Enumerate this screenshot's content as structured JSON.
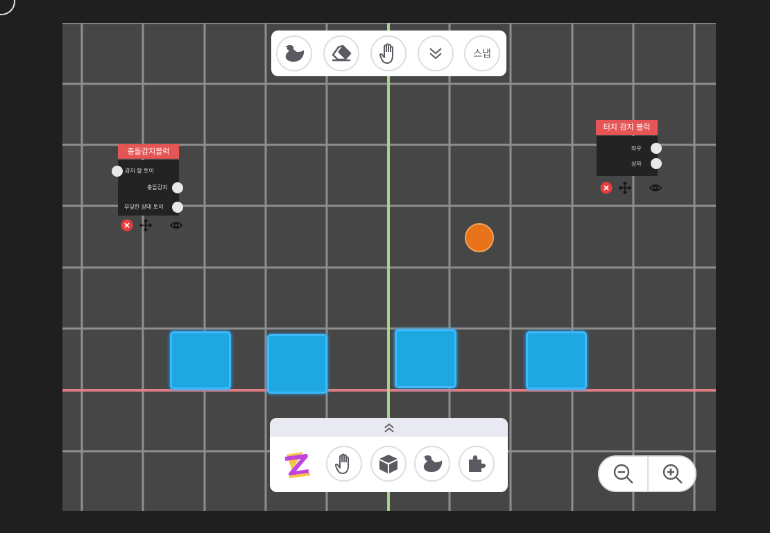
{
  "colors": {
    "background": "#1f1f1f",
    "canvas": "#464646",
    "grid": "#8e8e8e",
    "y_axis": "#a6d38a",
    "ground_line": "#e07d85",
    "block_title": "#e55555",
    "cube_fill": "#1ea7e1",
    "ball": "#e8731b"
  },
  "top_toolbar": {
    "tools": [
      {
        "icon": "duck-icon"
      },
      {
        "icon": "eraser-icon"
      },
      {
        "icon": "hand-icon"
      },
      {
        "icon": "chevron-double-down-icon"
      },
      {
        "icon": "snap",
        "label": "스냅"
      }
    ]
  },
  "collision_block": {
    "title": "충돌감지블럭",
    "ports": [
      "감지 할 토이",
      "충돌감지",
      "부딪힌 상대 토이"
    ]
  },
  "touch_block": {
    "title": "터치 감지 블럭",
    "ports": [
      "좌우",
      "상하"
    ]
  },
  "bottom_toolbar": {
    "handle_icon": "chevron-double-up-icon",
    "tools": [
      {
        "icon": "app-logo"
      },
      {
        "icon": "hand-icon"
      },
      {
        "icon": "cube-icon"
      },
      {
        "icon": "duck-icon"
      },
      {
        "icon": "puzzle-icon"
      }
    ]
  },
  "zoom_controls": [
    "zoom-out-icon",
    "zoom-in-icon"
  ]
}
